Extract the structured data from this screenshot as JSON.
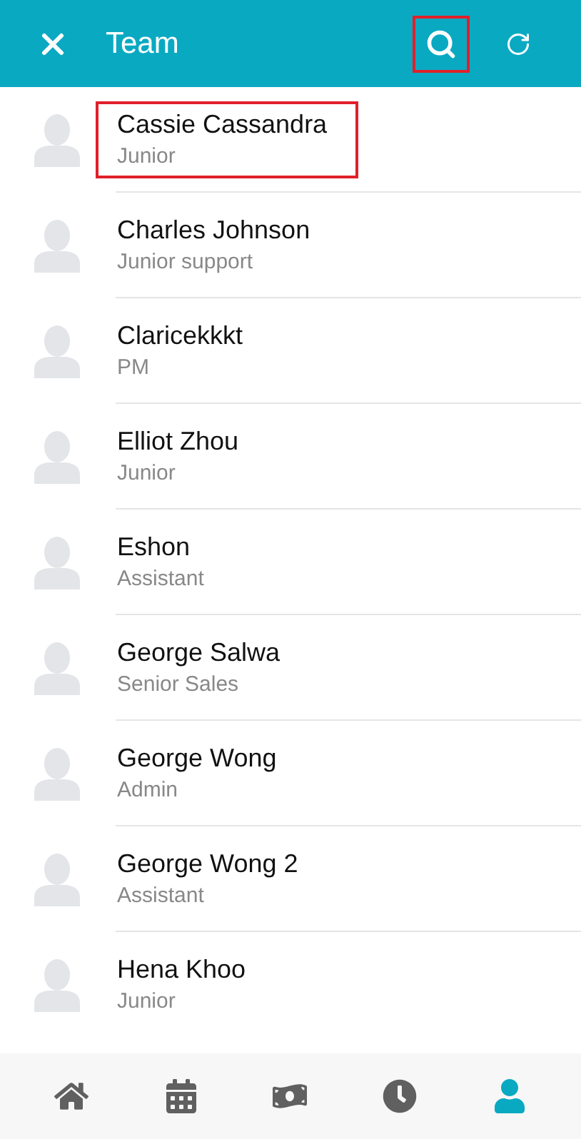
{
  "header": {
    "title": "Team",
    "search_highlighted": true
  },
  "contacts": [
    {
      "name": "Cassie Cassandra",
      "role": "Junior",
      "highlighted": true
    },
    {
      "name": "Charles Johnson",
      "role": "Junior support",
      "highlighted": false
    },
    {
      "name": "Claricekkkt",
      "role": "PM",
      "highlighted": false
    },
    {
      "name": "Elliot Zhou",
      "role": "Junior",
      "highlighted": false
    },
    {
      "name": "Eshon",
      "role": "Assistant",
      "highlighted": false
    },
    {
      "name": "George Salwa",
      "role": "Senior Sales",
      "highlighted": false
    },
    {
      "name": "George Wong",
      "role": "Admin",
      "highlighted": false
    },
    {
      "name": "George Wong 2",
      "role": "Assistant",
      "highlighted": false
    },
    {
      "name": "Hena Khoo",
      "role": "Junior",
      "highlighted": false
    }
  ],
  "bottom_nav": [
    {
      "kind": "home",
      "selected": false
    },
    {
      "kind": "calendar",
      "selected": false
    },
    {
      "kind": "money",
      "selected": false
    },
    {
      "kind": "clock",
      "selected": false
    },
    {
      "kind": "person",
      "selected": true
    }
  ]
}
